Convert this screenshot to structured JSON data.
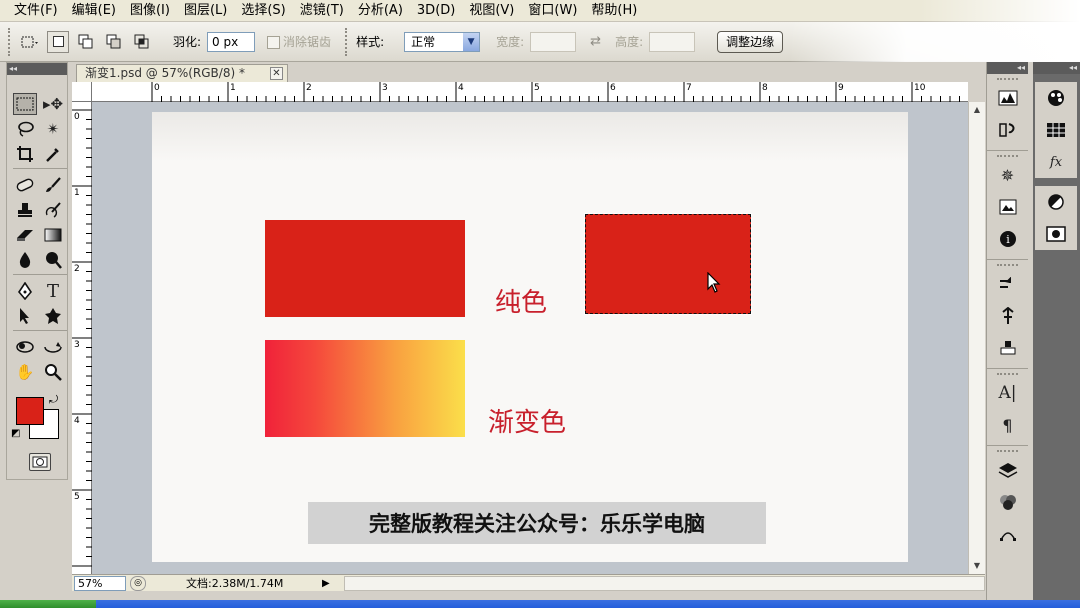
{
  "menu": [
    "文件(F)",
    "编辑(E)",
    "图像(I)",
    "图层(L)",
    "选择(S)",
    "滤镜(T)",
    "分析(A)",
    "3D(D)",
    "视图(V)",
    "窗口(W)",
    "帮助(H)"
  ],
  "options": {
    "feather_label": "羽化:",
    "feather_value": "0 px",
    "antialias_label": "消除锯齿",
    "style_label": "样式:",
    "style_value": "正常",
    "width_label": "宽度:",
    "height_label": "高度:",
    "refine_edge_button": "调整边缘"
  },
  "document": {
    "tab_title": "渐变1.psd @ 57%(RGB/8) *",
    "zoom": "57%",
    "doc_info": "文档:2.38M/1.74M"
  },
  "ruler": {
    "h_ticks": [
      "0",
      "1",
      "2",
      "3",
      "4",
      "5",
      "6",
      "7",
      "8",
      "9",
      "10"
    ],
    "v_ticks": [
      "0",
      "1",
      "2",
      "3",
      "4",
      "5"
    ]
  },
  "canvas": {
    "solid_label": "纯色",
    "gradient_label": "渐变色",
    "banner": "完整版教程关注公众号：乐乐学电脑",
    "colors": {
      "solid_fill": "#d92218",
      "gradient_start": "#f0223a",
      "gradient_end": "#fbdf4a",
      "label_color": "#c8202c"
    }
  },
  "toolbox": {
    "foreground_color": "#d92218",
    "background_color": "#ffffff",
    "tools": [
      "rectangular-marquee-icon",
      "move-icon",
      "lasso-icon",
      "magic-wand-icon",
      "crop-icon",
      "eyedropper-icon",
      "healing-brush-icon",
      "brush-icon",
      "clone-stamp-icon",
      "history-brush-icon",
      "eraser-icon",
      "gradient-icon",
      "blur-icon",
      "dodge-icon",
      "pen-icon",
      "type-icon",
      "path-selection-icon",
      "custom-shape-icon",
      "3d-rotate-icon",
      "3d-orbit-icon",
      "hand-icon",
      "zoom-icon"
    ]
  },
  "panels": {
    "right_dock": [
      "histogram-icon",
      "history-icon",
      "navigator-icon",
      "info-icon",
      "color-icon",
      "swatches-icon",
      "styles-icon",
      "brushes-icon",
      "clone-source-icon",
      "tool-presets-icon",
      "character-icon",
      "paragraph-icon",
      "layers-3d-icon",
      "channels-icon",
      "paths-icon"
    ],
    "far_right_dock": [
      "color-icon",
      "swatches-icon",
      "styles-icon",
      "adjustments-icon",
      "masks-icon"
    ]
  }
}
